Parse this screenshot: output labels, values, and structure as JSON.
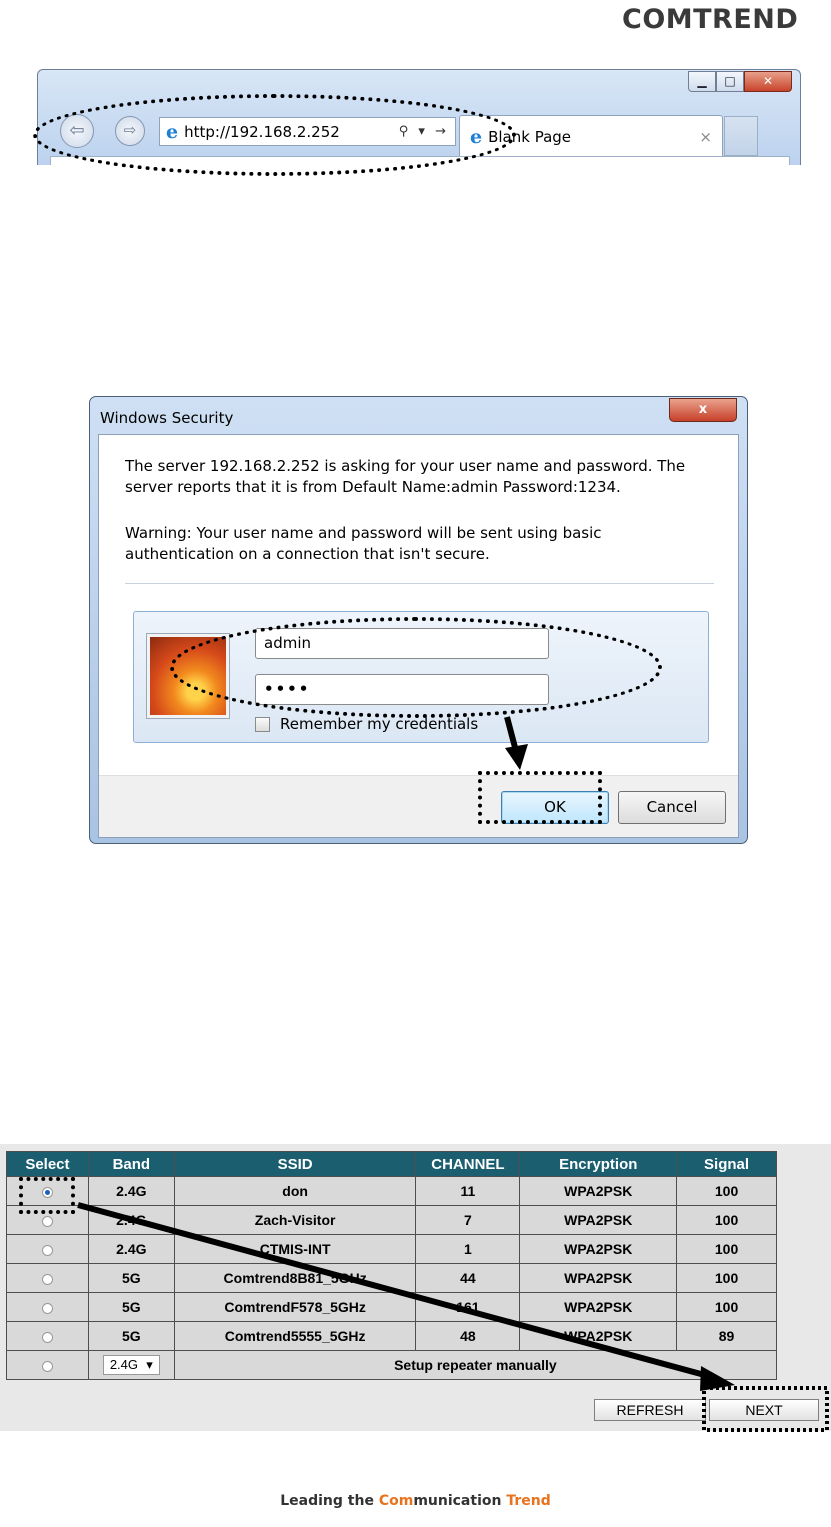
{
  "logo": "COMTREND",
  "browser": {
    "url": "http://192.168.2.252",
    "tab_label": "Blank Page",
    "tab_close": "×",
    "address_tools": "⚲ ▾ →"
  },
  "dialog": {
    "title": "Windows Security",
    "message": "The server 192.168.2.252 is asking for your user name and password. The server reports that it is from Default Name:admin Password:1234.",
    "warning": "Warning: Your user name and password will be sent using basic authentication on a connection that isn't secure.",
    "username_value": "admin",
    "password_value": "••••",
    "remember_label": "Remember my credentials",
    "ok_label": "OK",
    "cancel_label": "Cancel",
    "close_glyph": "x"
  },
  "survey": {
    "headers": [
      "Select",
      "Band",
      "SSID",
      "CHANNEL",
      "Encryption",
      "Signal"
    ],
    "rows": [
      {
        "band": "2.4G",
        "ssid": "don",
        "channel": "11",
        "encryption": "WPA2PSK",
        "signal": "100",
        "selected": true
      },
      {
        "band": "2.4G",
        "ssid": "Zach-Visitor",
        "channel": "7",
        "encryption": "WPA2PSK",
        "signal": "100",
        "selected": false
      },
      {
        "band": "2.4G",
        "ssid": "CTMIS-INT",
        "channel": "1",
        "encryption": "WPA2PSK",
        "signal": "100",
        "selected": false
      },
      {
        "band": "5G",
        "ssid": "Comtrend8B81_5GHz",
        "channel": "44",
        "encryption": "WPA2PSK",
        "signal": "100",
        "selected": false
      },
      {
        "band": "5G",
        "ssid": "ComtrendF578_5GHz",
        "channel": "161",
        "encryption": "WPA2PSK",
        "signal": "100",
        "selected": false
      },
      {
        "band": "5G",
        "ssid": "Comtrend5555_5GHz",
        "channel": "48",
        "encryption": "WPA2PSK",
        "signal": "89",
        "selected": false
      }
    ],
    "manual_band": "2.4G",
    "manual_label": "Setup repeater manually",
    "refresh_label": "REFRESH",
    "next_label": "NEXT"
  },
  "footer": {
    "part1": "Leading the ",
    "part2": "Com",
    "part3": "munication ",
    "part4": "Trend"
  }
}
